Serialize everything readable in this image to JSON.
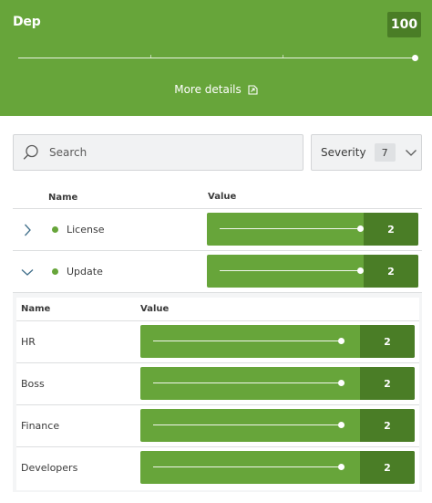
{
  "header": {
    "title": "Dep",
    "score": "100",
    "more_details_label": "More details",
    "level_fraction": 1.0
  },
  "filters": {
    "search_placeholder": "Search",
    "severity_label": "Severity",
    "severity_count": "7"
  },
  "table": {
    "columns": {
      "name": "Name",
      "value": "Value"
    },
    "rows": [
      {
        "name": "License",
        "count": "2",
        "level_fraction": 0.98,
        "expanded": false
      },
      {
        "name": "Update",
        "count": "2",
        "level_fraction": 0.98,
        "expanded": true
      }
    ]
  },
  "subtable": {
    "columns": {
      "name": "Name",
      "value": "Value"
    },
    "rows": [
      {
        "name": "HR",
        "count": "2",
        "level_fraction": 0.98
      },
      {
        "name": "Boss",
        "count": "2",
        "level_fraction": 0.98
      },
      {
        "name": "Finance",
        "count": "2",
        "level_fraction": 0.98
      },
      {
        "name": "Developers",
        "count": "2",
        "level_fraction": 0.98
      }
    ]
  },
  "colors": {
    "accent": "#67a53a",
    "accent_dark": "#4a7d26"
  }
}
